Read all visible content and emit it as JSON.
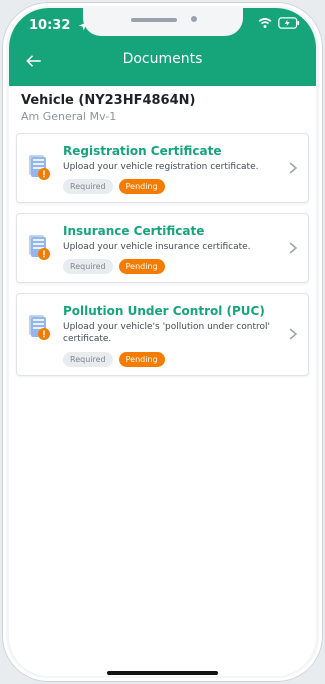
{
  "status": {
    "time": "10:32"
  },
  "appbar": {
    "title": "Documents"
  },
  "vehicle": {
    "title": "Vehicle (NY23HF4864N)",
    "subtitle": "Am General Mv-1"
  },
  "documents": [
    {
      "title": "Registration Certificate",
      "description": "Upload your vehicle registration certificate.",
      "badges": [
        "Required",
        "Pending"
      ]
    },
    {
      "title": "Insurance Certificate",
      "description": "Upload your vehicle insurance certificate.",
      "badges": [
        "Required",
        "Pending"
      ]
    },
    {
      "title": "Pollution Under Control (PUC)",
      "description": "Upload your vehicle's 'pollution under control' certificate.",
      "badges": [
        "Required",
        "Pending"
      ]
    }
  ],
  "colors": {
    "accent": "#16a57a",
    "pending": "#f57c00"
  }
}
